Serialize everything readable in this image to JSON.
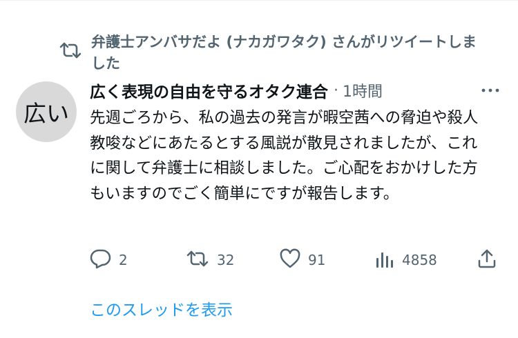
{
  "retweet": {
    "text": "弁護士アンバサだよ (ナカガワタク) さんがリツイートしました",
    "icon": "retweet-icon"
  },
  "tweet": {
    "avatar_text": "広い",
    "display_name": "広く表現の自由を守るオタク連合",
    "separator": "·",
    "time": "1時間",
    "body": "先週ごろから、私の過去の発言が暇空茜への脅迫や殺人教唆などにあたるとする風説が散見されましたが、これに関して弁護士に相談しました。ご心配をおかけした方もいますのでごく簡単にですが報告します。"
  },
  "actions": {
    "reply": {
      "icon": "reply-icon",
      "count": "2"
    },
    "retweet": {
      "icon": "retweet-icon",
      "count": "32"
    },
    "like": {
      "icon": "heart-icon",
      "count": "91"
    },
    "views": {
      "icon": "analytics-icon",
      "count": "4858"
    },
    "share": {
      "icon": "share-icon"
    }
  },
  "thread_link": "このスレッドを表示",
  "colors": {
    "text": "#0f1419",
    "secondary": "#536471",
    "link": "#1d9bf0",
    "avatar_bg": "#d9d9d9"
  }
}
